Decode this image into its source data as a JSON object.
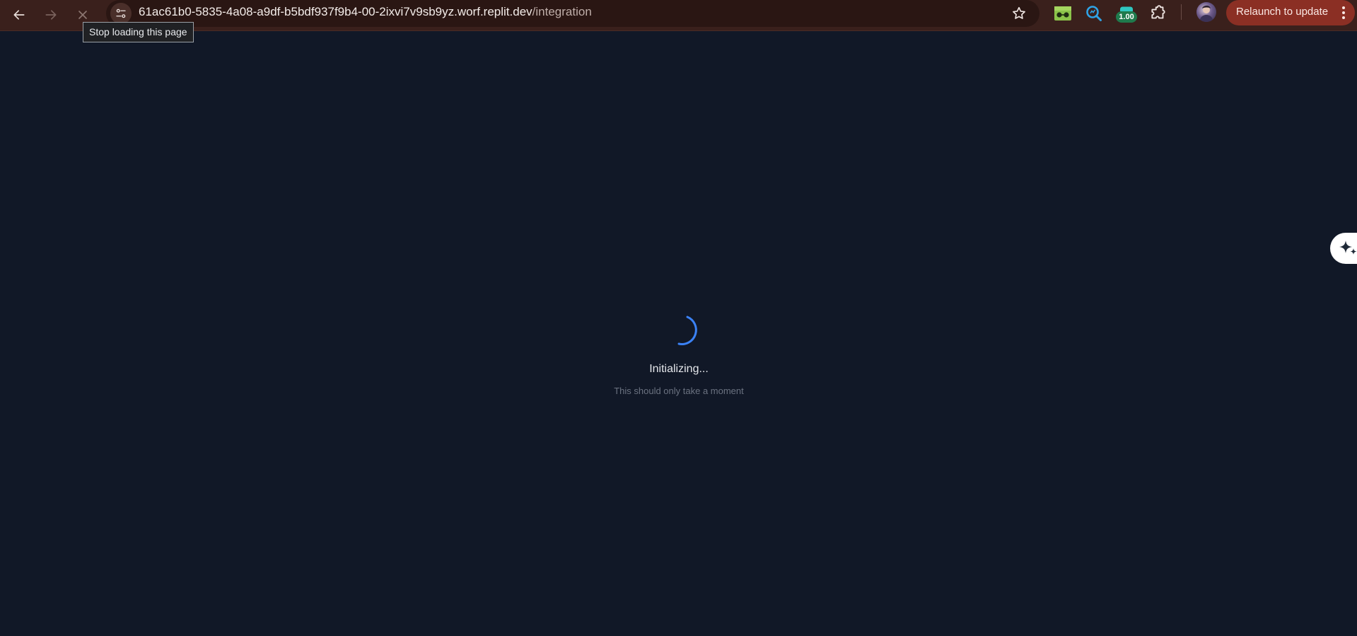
{
  "browser": {
    "url_host": "61ac61b0-5835-4a08-a9df-b5bdf937f9b4-00-2ixvi7v9sb9yz.worf.replit.dev",
    "url_path": "/integration",
    "tooltip": "Stop loading this page",
    "extension_badge": "1.00",
    "relaunch_label": "Relaunch to update",
    "icons": {
      "back": "arrow-left-icon",
      "forward": "arrow-right-icon",
      "stop": "close-icon",
      "site_info": "tune-icon",
      "bookmark": "star-icon",
      "extensions": "puzzle-icon",
      "menu": "kebab-menu-icon"
    },
    "colors": {
      "toolbar": "#3a201c",
      "omnibox": "#2a1613",
      "relaunch_button": "#8b2f24"
    }
  },
  "page": {
    "loading_title": "Initializing...",
    "loading_subtitle": "This should only take a moment",
    "colors": {
      "background": "#111827",
      "spinner": "#3b82f6"
    }
  }
}
